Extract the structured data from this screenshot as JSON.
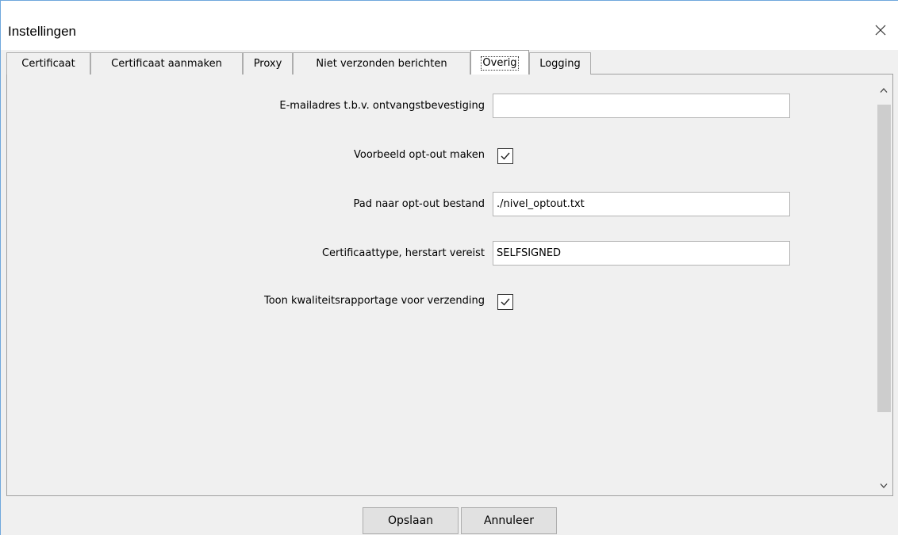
{
  "window": {
    "title": "Instellingen",
    "close_icon": "close-icon"
  },
  "tabs": [
    {
      "label": "Certificaat",
      "active": false
    },
    {
      "label": "Certificaat aanmaken",
      "active": false
    },
    {
      "label": "Proxy",
      "active": false
    },
    {
      "label": "Niet verzonden berichten",
      "active": false
    },
    {
      "label": "Overig",
      "active": true
    },
    {
      "label": "Logging",
      "active": false
    }
  ],
  "form": {
    "email": {
      "label": "E-mailadres t.b.v. ontvangstbevestiging",
      "value": ""
    },
    "optout_example": {
      "label": "Voorbeeld opt-out maken",
      "checked": true
    },
    "optout_path": {
      "label": "Pad naar opt-out bestand",
      "value": "./nivel_optout.txt"
    },
    "cert_type": {
      "label": "Certificaattype, herstart vereist",
      "value": "SELFSIGNED"
    },
    "quality_report": {
      "label": "Toon kwaliteitsrapportage voor verzending",
      "checked": true
    }
  },
  "buttons": {
    "save": "Opslaan",
    "cancel": "Annuleer"
  },
  "colors": {
    "window_border": "#6fa8dc",
    "background": "#f0f0f0"
  }
}
